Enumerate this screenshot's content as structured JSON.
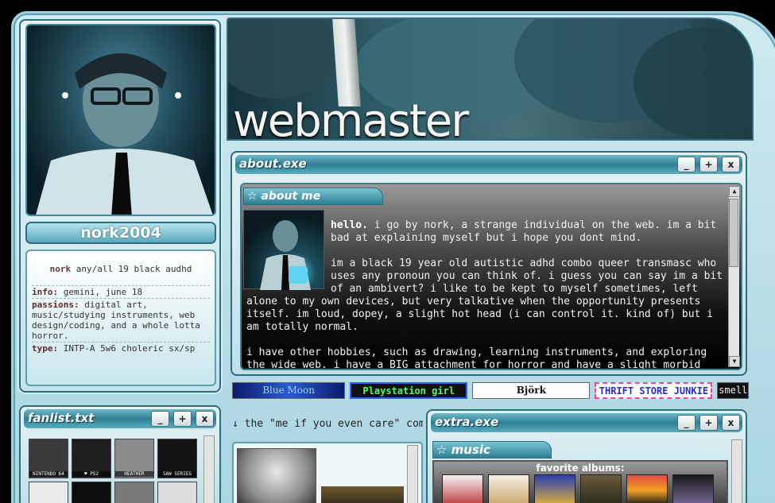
{
  "profile": {
    "username": "nork2004",
    "tagline_name": "nork",
    "tagline_rest": "any/all 19 black audhd",
    "info_label": "info:",
    "info_value": "gemini, june 18",
    "passions_label": "passions:",
    "passions_value": "digital art, music/studying instruments, web design/coding, and a whole lotta horror.",
    "type_label": "type:",
    "type_value": "INTP-A 5w6 choleric sx/sp"
  },
  "header": {
    "title": "webmaster"
  },
  "about_window": {
    "title": "about.exe",
    "tab": "about me",
    "hello": "hello.",
    "p1": "i go by nork, a strange individual on the web. im a bit bad at explaining myself but i hope you dont mind.",
    "p2": "im a black 19 year old autistic adhd combo queer transmasc who uses any pronoun you can think of. i guess you can say im a bit of an ambivert? i like to be kept to myself sometimes, left alone to my own devices, but very talkative when the opportunity presents itself. im loud, dopey, a slight hot head (i can control it. kind of) but i am totally normal.",
    "p3": "i have other hobbies, such as drawing, learning instruments, and exploring the wide web. i have a BIG attachment for horror and have a slight morbid curiosity, almost watching/playing any horror media out there available for me and indulging myself in"
  },
  "window_buttons": {
    "minimize": "_",
    "maximize": "+",
    "close": "x"
  },
  "scroll": {
    "up": "▲",
    "down": "▼"
  },
  "blinkies": [
    "Blue Moon",
    "Playstation girl",
    "Björk",
    "THRIFT STORE JUNKIE",
    "smell"
  ],
  "fanlist": {
    "title": "fanlist.txt",
    "items": [
      "NINTENDO 64",
      "♥ PS2",
      "HEATHER",
      "SAW SERIES",
      "",
      "",
      "",
      ""
    ]
  },
  "marquee": "↓ the \"me if you even care\" comp",
  "extra_window": {
    "title": "extra.exe",
    "tab": "music",
    "albums_title": "favorite albums:"
  },
  "colors": {
    "accent": "#2e7f94",
    "frame": "#a9d5e1"
  }
}
